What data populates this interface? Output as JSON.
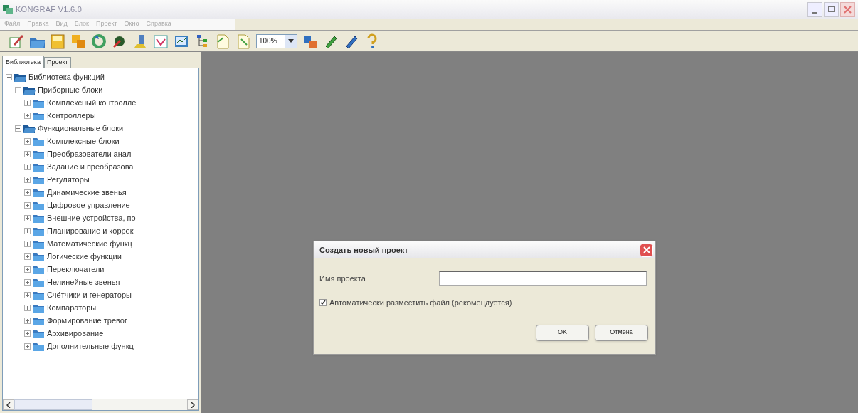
{
  "window": {
    "title": "KONGRAF V1.6.0"
  },
  "menu": [
    "Файл",
    "Правка",
    "Вид",
    "Блок",
    "Проект",
    "Окно",
    "Справка"
  ],
  "toolbar": {
    "zoom": "100%"
  },
  "sidebar": {
    "tabs": [
      {
        "label": "Библиотека",
        "selected": true
      },
      {
        "label": "Проект",
        "selected": false
      }
    ],
    "tree": [
      {
        "label": "Библиотека функций",
        "expanded": true,
        "children": [
          {
            "label": "Приборные блоки",
            "expanded": true,
            "children": [
              {
                "label": "Комплексный контролле",
                "expanded": false
              },
              {
                "label": "Контроллеры",
                "expanded": false
              }
            ]
          },
          {
            "label": "Функциональные блоки",
            "expanded": true,
            "children": [
              {
                "label": "Комплексные блоки",
                "expanded": false
              },
              {
                "label": "Преобразователи анал",
                "expanded": false
              },
              {
                "label": "Задание и преобразова",
                "expanded": false
              },
              {
                "label": "Регуляторы",
                "expanded": false
              },
              {
                "label": "Динамические звенья",
                "expanded": false
              },
              {
                "label": "Цифровое управление",
                "expanded": false
              },
              {
                "label": "Внешние устройства, по",
                "expanded": false
              },
              {
                "label": "Планирование и коррек",
                "expanded": false
              },
              {
                "label": "Математические функц",
                "expanded": false
              },
              {
                "label": "Логические функции",
                "expanded": false
              },
              {
                "label": "Переключатели",
                "expanded": false
              },
              {
                "label": "Нелинейные звенья",
                "expanded": false
              },
              {
                "label": "Счётчики и генераторы",
                "expanded": false
              },
              {
                "label": "Компараторы",
                "expanded": false
              },
              {
                "label": "Формирование тревог",
                "expanded": false
              },
              {
                "label": "Архивирование",
                "expanded": false
              },
              {
                "label": "Дополнительные функц",
                "expanded": false
              }
            ]
          }
        ]
      }
    ]
  },
  "dialog": {
    "title": "Создать новый проект",
    "field_label": "Имя проекта",
    "checkbox": {
      "label": "Автоматически разместить файл (рекомендуется)",
      "checked": true
    },
    "buttons": [
      "OK",
      "Отмена"
    ]
  }
}
